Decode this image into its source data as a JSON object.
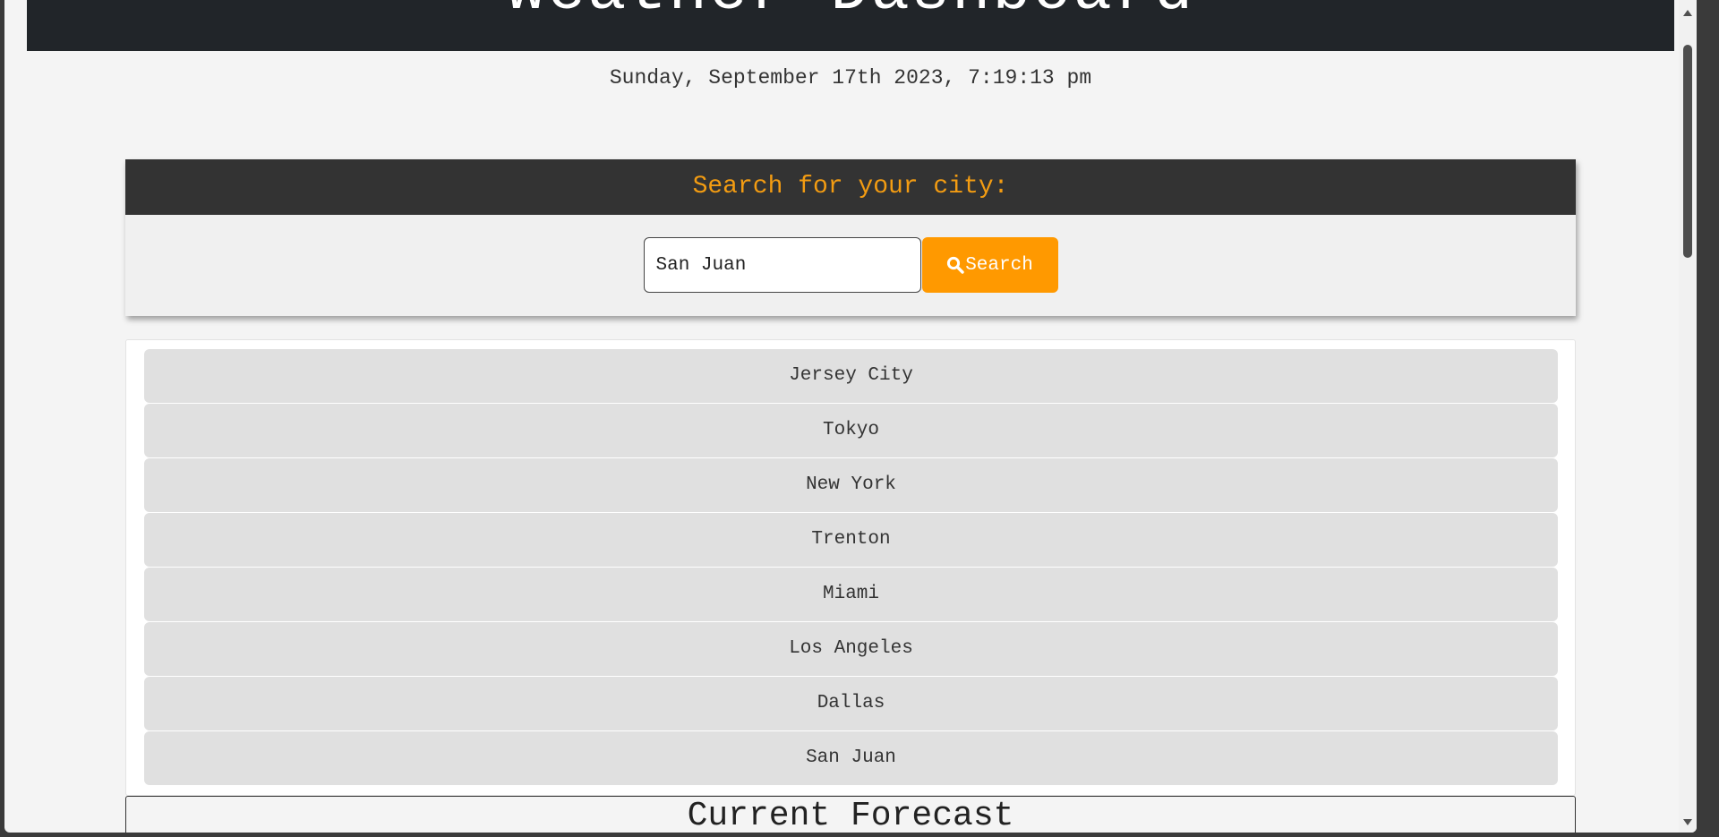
{
  "header": {
    "title": "Weather Dashboard"
  },
  "datetime": "Sunday, September 17th 2023, 7:19:13 pm",
  "search": {
    "heading": "Search for your city:",
    "input_value": "San Juan",
    "button_label": "Search",
    "button_icon": "magnifier-icon"
  },
  "history": {
    "cities": [
      "Jersey City",
      "Tokyo",
      "New York",
      "Trenton",
      "Miami",
      "Los Angeles",
      "Dallas",
      "San Juan"
    ]
  },
  "forecast": {
    "heading": "Current Forecast"
  },
  "colors": {
    "header_bg": "#212529",
    "accent": "#ff9900",
    "search_heading": "#f39c12",
    "city_button_bg": "#e0e0e0"
  }
}
